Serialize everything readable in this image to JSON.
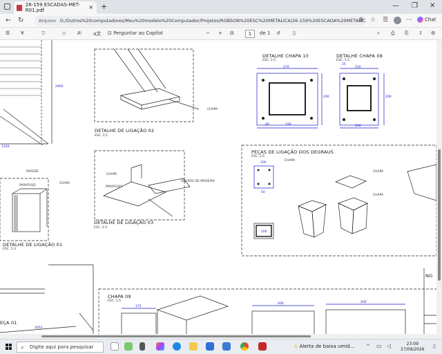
{
  "browser": {
    "tab_title": "26-159 ESCADAS-MET-R01.pdf",
    "close_glyph": "×",
    "new_tab_glyph": "+",
    "win_min": "—",
    "win_max": "❐",
    "win_close": "✕",
    "url_label": "Arquivo",
    "url": "G:/Outros%20computadores/Meu%20modelo%20Computador/Projetos/ROBSON%20ESC%20METALICA/26-159%20ESCADA%20METALIC...",
    "chat_label": "Chat"
  },
  "pdf_toolbar": {
    "copilot_label": "Perguntar ao Copilot",
    "zoom_out": "−",
    "zoom_in": "+",
    "page_current": "1",
    "page_total": "de 1"
  },
  "drawing": {
    "labels": {
      "detalhe_02": "DETALHE DE LIGAÇÃO 02",
      "detalhe_03": "DETALHE DE LIGAÇÃO 03",
      "detalhe_01": "DETALHE DE LIGAÇÃO 01",
      "chapa_10": "DETALHE CHAPA 10",
      "chapa_08": "DETALHE CHAPA 08",
      "pecas": "PEÇAS DE LIGAÇÃO DOS DEGRAUS",
      "chapa_09": "CHAPA 09",
      "peca_01": "EÇA 01",
      "esc_15": "ESC.:1:5",
      "esc_13": "ESC.:1:3",
      "chapa": "CHAPA",
      "parede": "PAREDE",
      "parafuso": "PARAFUSO",
      "degrau": "DEGRAU DE MADEIRA",
      "no": "NO"
    },
    "dims": {
      "d270": "270",
      "d190": "190",
      "d200": "200",
      "d40": "40",
      "d25": "25",
      "d150": "150",
      "d100": "100",
      "d175": "175",
      "d400": "400",
      "d2400": "2400",
      "d1320": "1320",
      "d2052": "2052",
      "d50": "50"
    }
  },
  "taskbar": {
    "search_placeholder": "Digite aqui para pesquisar",
    "alert_text": "Alerta de baixa umid...",
    "time": "23:09",
    "date": "27/09/2026"
  },
  "colors": {
    "accent": "#1a1ad0",
    "line": "#222222"
  }
}
